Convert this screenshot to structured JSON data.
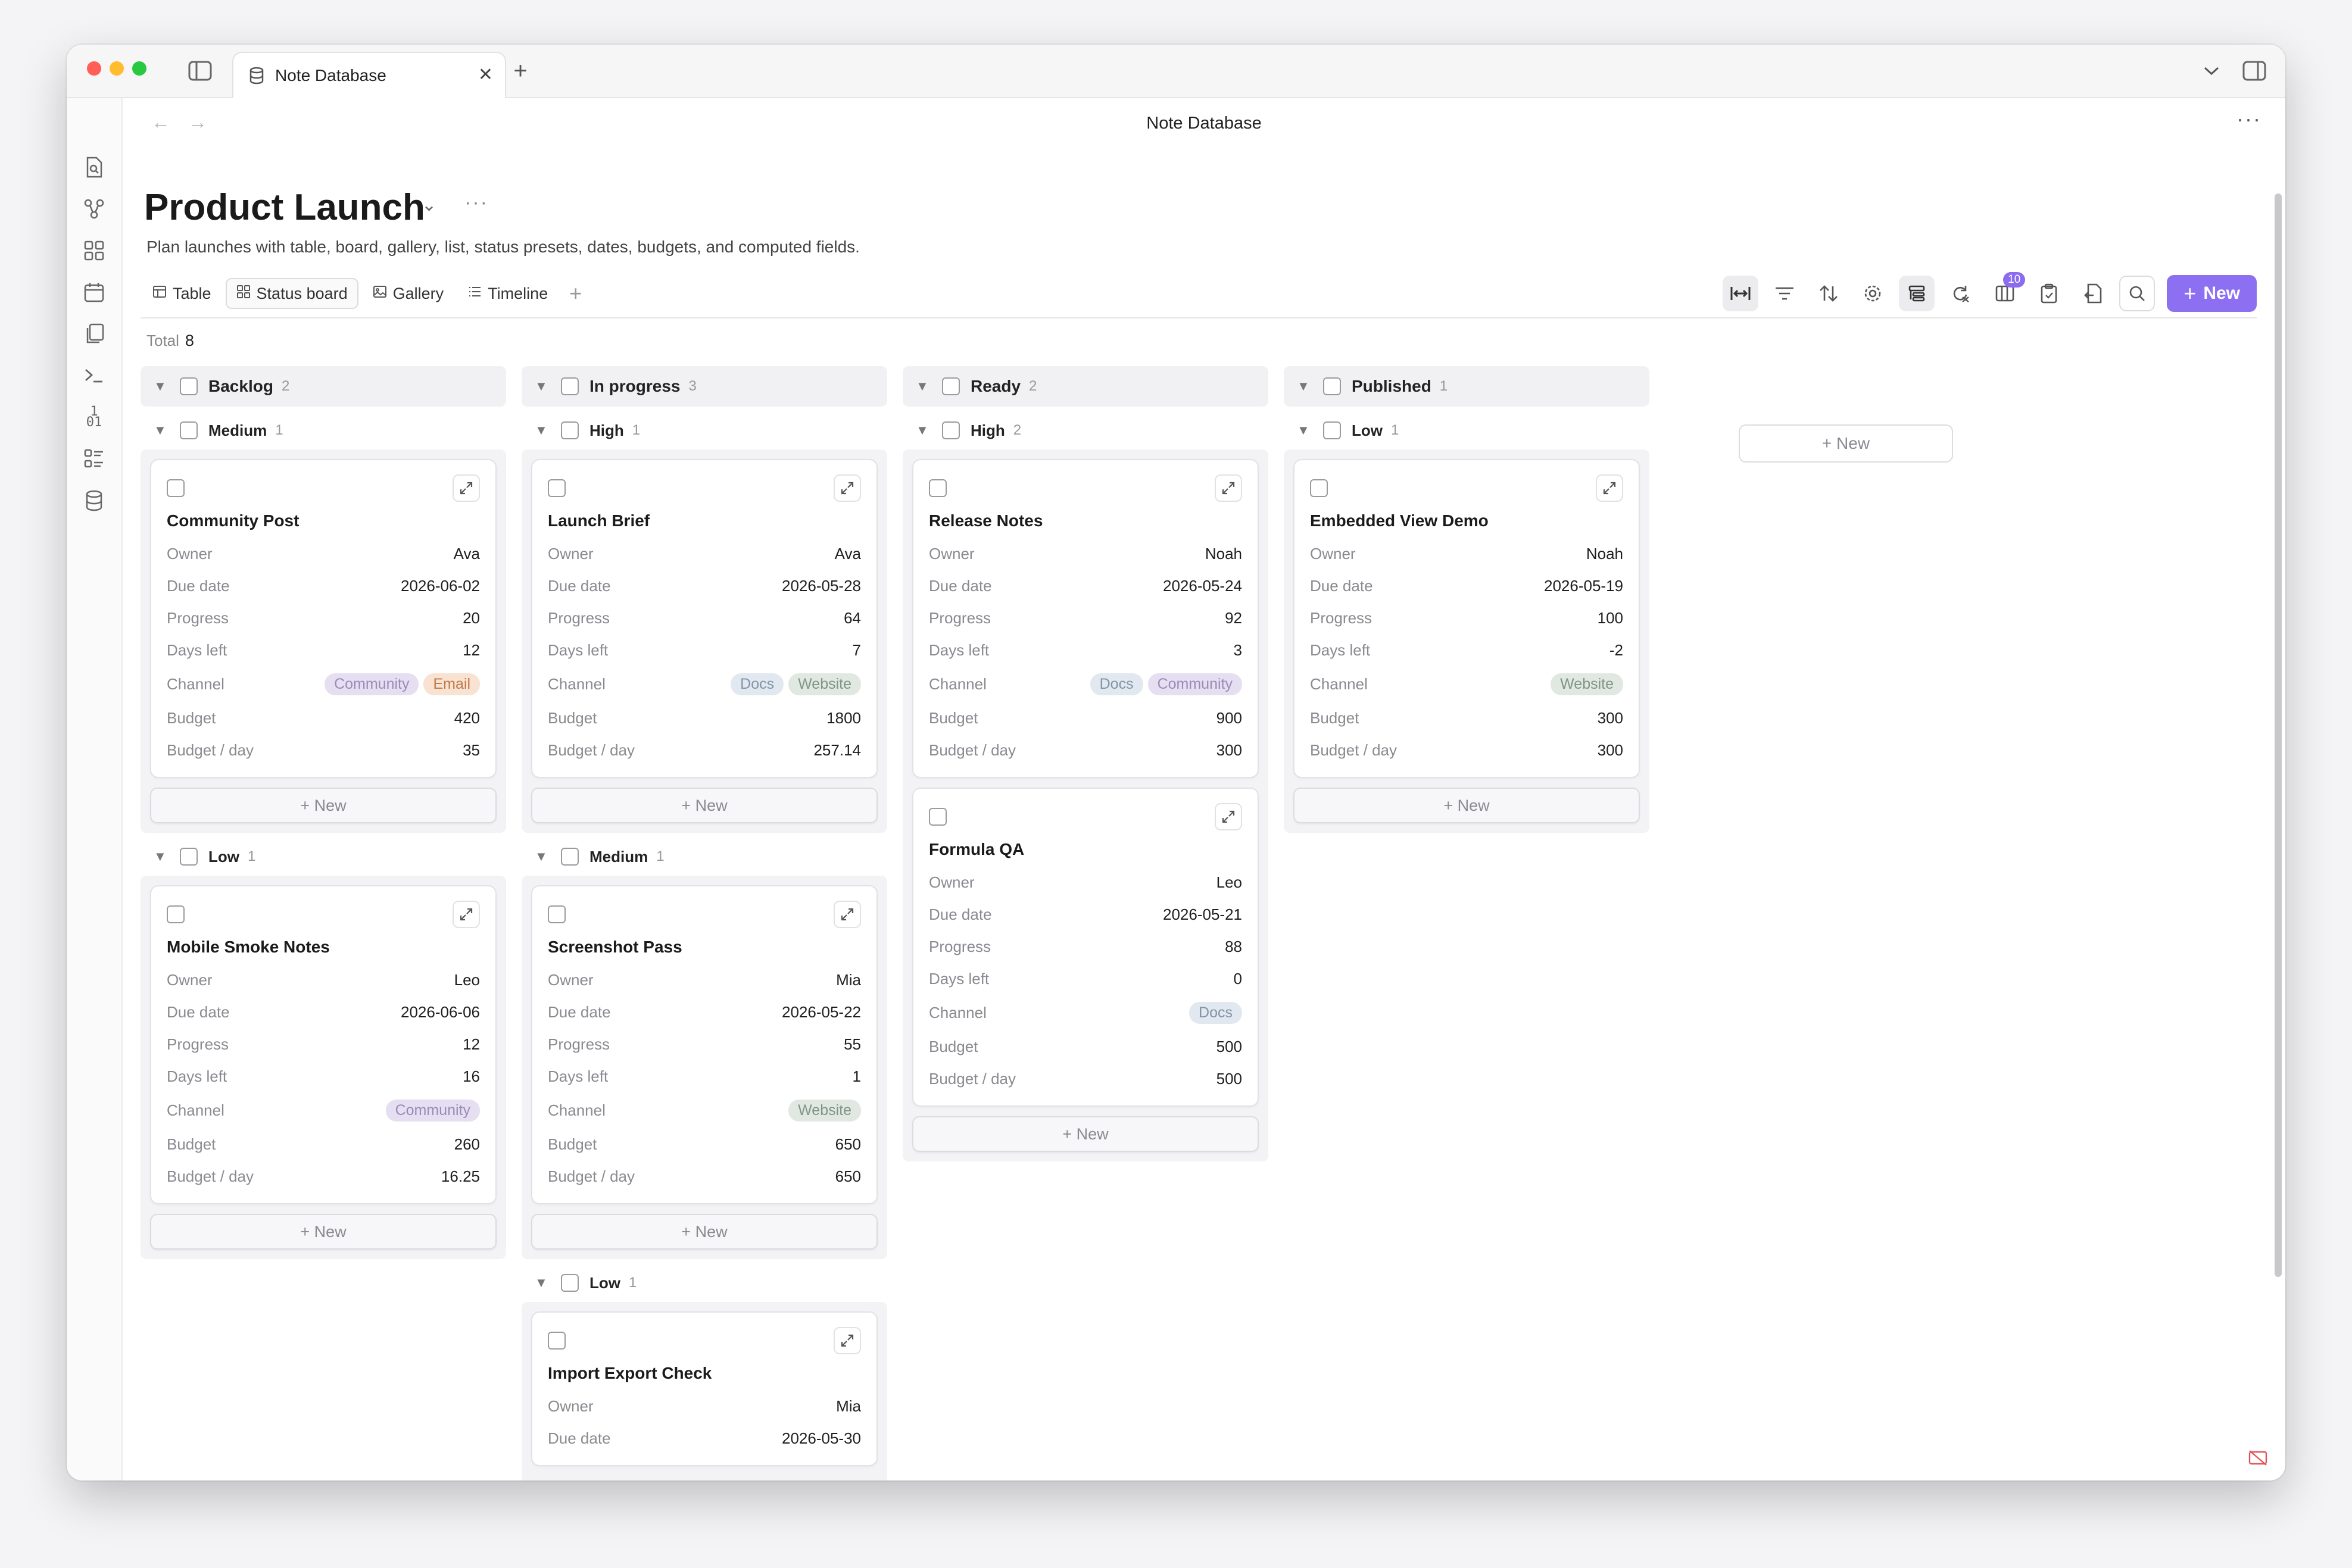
{
  "window": {
    "tab_title": "Note Database",
    "page_title": "Note Database",
    "traffic_colors": [
      "#ff5f57",
      "#febc2e",
      "#28c840"
    ]
  },
  "database": {
    "title": "Product Launch",
    "description": "Plan launches with table, board, gallery, list, status presets, dates, budgets, and computed fields."
  },
  "views": [
    {
      "label": "Table",
      "icon": "table-icon",
      "active": false
    },
    {
      "label": "Status board",
      "icon": "board-icon",
      "active": true
    },
    {
      "label": "Gallery",
      "icon": "gallery-icon",
      "active": false
    },
    {
      "label": "Timeline",
      "icon": "list-icon",
      "active": false
    }
  ],
  "toolbar": {
    "properties_badge": "10",
    "new_label": "New"
  },
  "total": {
    "label": "Total",
    "count": "8"
  },
  "add_label": "+ New",
  "field_labels": {
    "owner": "Owner",
    "due": "Due date",
    "progress": "Progress",
    "days_left": "Days left",
    "channel": "Channel",
    "budget": "Budget",
    "budget_day": "Budget / day"
  },
  "tag_colors": {
    "Community": {
      "bg": "#e6dff2",
      "fg": "#9b8bb8"
    },
    "Email": {
      "bg": "#f8e2d2",
      "fg": "#c27a48"
    },
    "Docs": {
      "bg": "#e1e8f0",
      "fg": "#8294a8"
    },
    "Website": {
      "bg": "#e1e8e2",
      "fg": "#7f9585"
    }
  },
  "columns": [
    {
      "name": "Backlog",
      "count": "2",
      "groups": [
        {
          "name": "Medium",
          "count": "1",
          "cards": [
            {
              "title": "Community Post",
              "owner": "Ava",
              "due": "2026-06-02",
              "progress": "20",
              "days_left": "12",
              "channels": [
                "Community",
                "Email"
              ],
              "budget": "420",
              "budget_day": "35"
            }
          ]
        },
        {
          "name": "Low",
          "count": "1",
          "cards": [
            {
              "title": "Mobile Smoke Notes",
              "owner": "Leo",
              "due": "2026-06-06",
              "progress": "12",
              "days_left": "16",
              "channels": [
                "Community"
              ],
              "budget": "260",
              "budget_day": "16.25"
            }
          ]
        }
      ]
    },
    {
      "name": "In progress",
      "count": "3",
      "groups": [
        {
          "name": "High",
          "count": "1",
          "cards": [
            {
              "title": "Launch Brief",
              "owner": "Ava",
              "due": "2026-05-28",
              "progress": "64",
              "days_left": "7",
              "channels": [
                "Docs",
                "Website"
              ],
              "budget": "1800",
              "budget_day": "257.14"
            }
          ]
        },
        {
          "name": "Medium",
          "count": "1",
          "cards": [
            {
              "title": "Screenshot Pass",
              "owner": "Mia",
              "due": "2026-05-22",
              "progress": "55",
              "days_left": "1",
              "channels": [
                "Website"
              ],
              "budget": "650",
              "budget_day": "650"
            }
          ]
        },
        {
          "name": "Low",
          "count": "1",
          "cards": [
            {
              "title": "Import Export Check",
              "owner": "Mia",
              "due": "2026-05-30",
              "progress": "",
              "days_left": "",
              "channels": [],
              "budget": "",
              "budget_day": "",
              "truncated": true
            }
          ]
        }
      ]
    },
    {
      "name": "Ready",
      "count": "2",
      "groups": [
        {
          "name": "High",
          "count": "2",
          "cards": [
            {
              "title": "Release Notes",
              "owner": "Noah",
              "due": "2026-05-24",
              "progress": "92",
              "days_left": "3",
              "channels": [
                "Docs",
                "Community"
              ],
              "budget": "900",
              "budget_day": "300"
            },
            {
              "title": "Formula QA",
              "owner": "Leo",
              "due": "2026-05-21",
              "progress": "88",
              "days_left": "0",
              "channels": [
                "Docs"
              ],
              "budget": "500",
              "budget_day": "500"
            }
          ]
        }
      ]
    },
    {
      "name": "Published",
      "count": "1",
      "groups": [
        {
          "name": "Low",
          "count": "1",
          "cards": [
            {
              "title": "Embedded View Demo",
              "owner": "Noah",
              "due": "2026-05-19",
              "progress": "100",
              "days_left": "-2",
              "channels": [
                "Website"
              ],
              "budget": "300",
              "budget_day": "300"
            }
          ]
        }
      ]
    }
  ]
}
